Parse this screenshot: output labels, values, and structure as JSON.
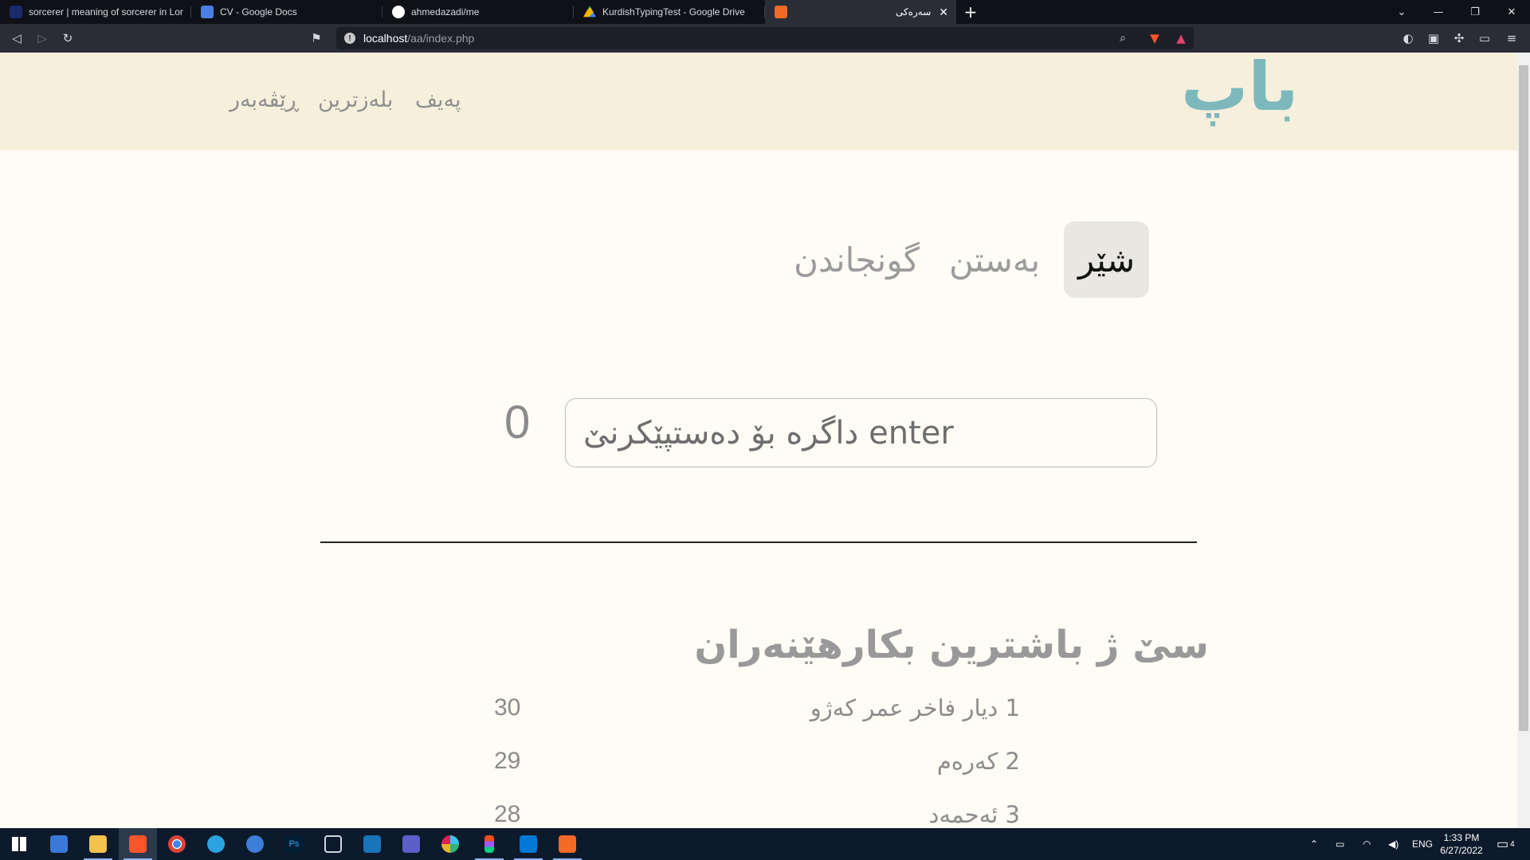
{
  "browser": {
    "tabs": [
      {
        "label": "sorcerer | meaning of sorcerer in Long",
        "icon": "longman-icon",
        "color": "#1b2a6b"
      },
      {
        "label": "CV - Google Docs",
        "icon": "google-docs-icon",
        "color": "#4a7fe0"
      },
      {
        "label": "ahmedazadi/me",
        "icon": "github-icon",
        "color": "#ffffff"
      },
      {
        "label": "KurdishTypingTest - Google Drive",
        "icon": "google-drive-icon",
        "color": "#f4b400"
      },
      {
        "label": "سەرەکی",
        "icon": "xampp-icon",
        "color": "#f36a27"
      }
    ],
    "url_host": "localhost",
    "url_path": "/aa/index.php"
  },
  "site": {
    "logo": "باپ",
    "nav": {
      "item1": "پەیف",
      "item2": "بلەزترین",
      "item3": "ڕێڤەبەر"
    },
    "modes": {
      "mode1": "شێر",
      "mode2": "بەستن",
      "mode3": "گونجاندن"
    },
    "counter": "0",
    "input_prompt": "enter داگرە بۆ دەستپێکرنێ",
    "board_title": "سێ ژ باشترین بکارهێنەران",
    "leaderboard": [
      {
        "name": "1 دیار فاخر عمر کەژو",
        "score": "30"
      },
      {
        "name": "2 کەرەم",
        "score": "29"
      },
      {
        "name": "3 ئەحمەد",
        "score": "28"
      }
    ],
    "accent_color": "#7db8bd"
  },
  "taskbar": {
    "lang": "ENG",
    "time": "1:33 PM",
    "date": "6/27/2022",
    "notifications": "4"
  }
}
